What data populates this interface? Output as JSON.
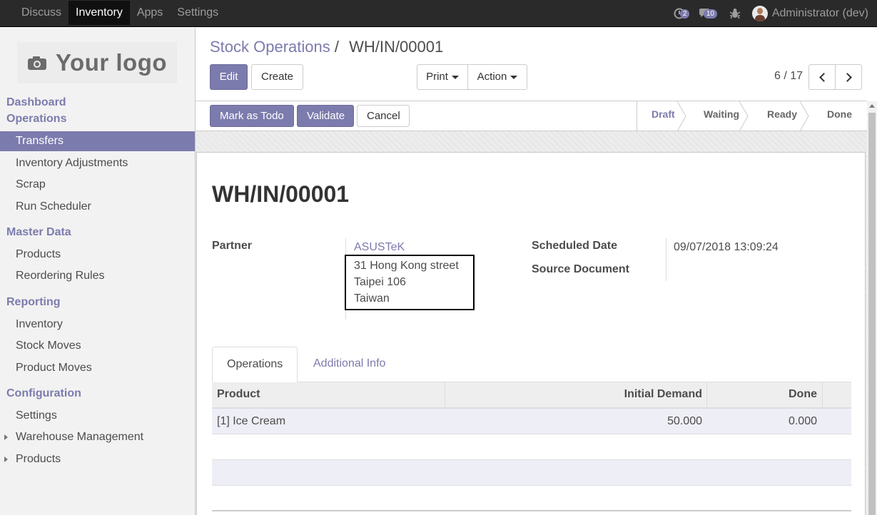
{
  "topbar": {
    "menu": [
      "Discuss",
      "Inventory",
      "Apps",
      "Settings"
    ],
    "active_menu": "Inventory",
    "activity_count": "2",
    "messages_count": "10",
    "user": "Administrator (dev)"
  },
  "sidebar": {
    "logo_text": "Your logo",
    "dashboard": "Dashboard",
    "operations": "Operations",
    "transfers": "Transfers",
    "inventory_adjustments": "Inventory Adjustments",
    "scrap": "Scrap",
    "run_scheduler": "Run Scheduler",
    "master_data": "Master Data",
    "products": "Products",
    "reordering_rules": "Reordering Rules",
    "reporting": "Reporting",
    "inventory": "Inventory",
    "stock_moves": "Stock Moves",
    "product_moves": "Product Moves",
    "configuration": "Configuration",
    "settings": "Settings",
    "warehouse_management": "Warehouse Management",
    "products_cfg": "Products"
  },
  "control": {
    "breadcrumb_parent": "Stock Operations",
    "breadcrumb_sep": "/",
    "breadcrumb_current": "WH/IN/00001",
    "edit": "Edit",
    "create": "Create",
    "print": "Print",
    "action": "Action",
    "pager": "6 / 17"
  },
  "statusbar": {
    "mark_todo": "Mark as Todo",
    "validate": "Validate",
    "cancel": "Cancel",
    "stages": [
      "Draft",
      "Waiting",
      "Ready",
      "Done"
    ],
    "current_stage": "Draft"
  },
  "form": {
    "title": "WH/IN/00001",
    "partner_label": "Partner",
    "partner_name": "ASUSTeK",
    "address_lines": [
      "31 Hong Kong street",
      "Taipei 106",
      "Taiwan"
    ],
    "scheduled_date_label": "Scheduled Date",
    "scheduled_date": "09/07/2018 13:09:24",
    "source_document_label": "Source Document",
    "tabs": [
      "Operations",
      "Additional Info"
    ],
    "table": {
      "headers": [
        "Product",
        "Initial Demand",
        "Done"
      ],
      "rows": [
        [
          "[1] Ice Cream",
          "50.000",
          "0.000"
        ]
      ]
    }
  },
  "colors": {
    "accent": "#7c7bad",
    "navbar": "#2a2a2a"
  },
  "icons": [
    "activity-clock-icon",
    "messages-icon",
    "debug-bug-icon",
    "camera-icon",
    "chevron-left-icon",
    "chevron-right-icon"
  ]
}
